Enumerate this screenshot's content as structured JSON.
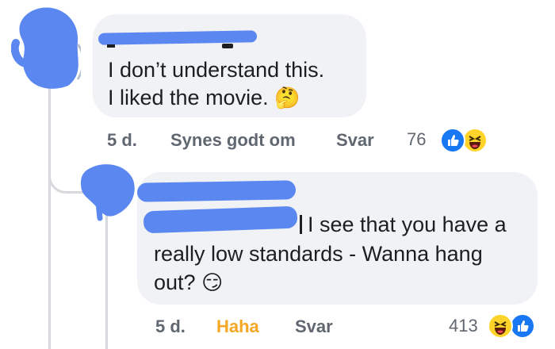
{
  "comment1": {
    "text_line1": "I don’t understand this.",
    "text_line2": "I liked the movie.",
    "emoji": "🤔",
    "time": "5 d.",
    "like_label": "Synes godt om",
    "reply_label": "Svar",
    "reaction_count": "76",
    "reactions": [
      "like-icon",
      "haha-icon"
    ]
  },
  "comment2": {
    "text_line1": "I see that you have a",
    "text_line2": "really low standards - Wanna hang",
    "text_line3": "out?",
    "emoji": "😏",
    "time": "5 d.",
    "reaction_label": "Haha",
    "reply_label": "Svar",
    "reaction_count": "413",
    "reactions": [
      "haha-icon",
      "like-icon"
    ]
  },
  "colors": {
    "redaction": "#5b87f0",
    "haha_active": "#f5a623",
    "bubble": "#f0f2f5",
    "like_blue": "#1877f2"
  }
}
